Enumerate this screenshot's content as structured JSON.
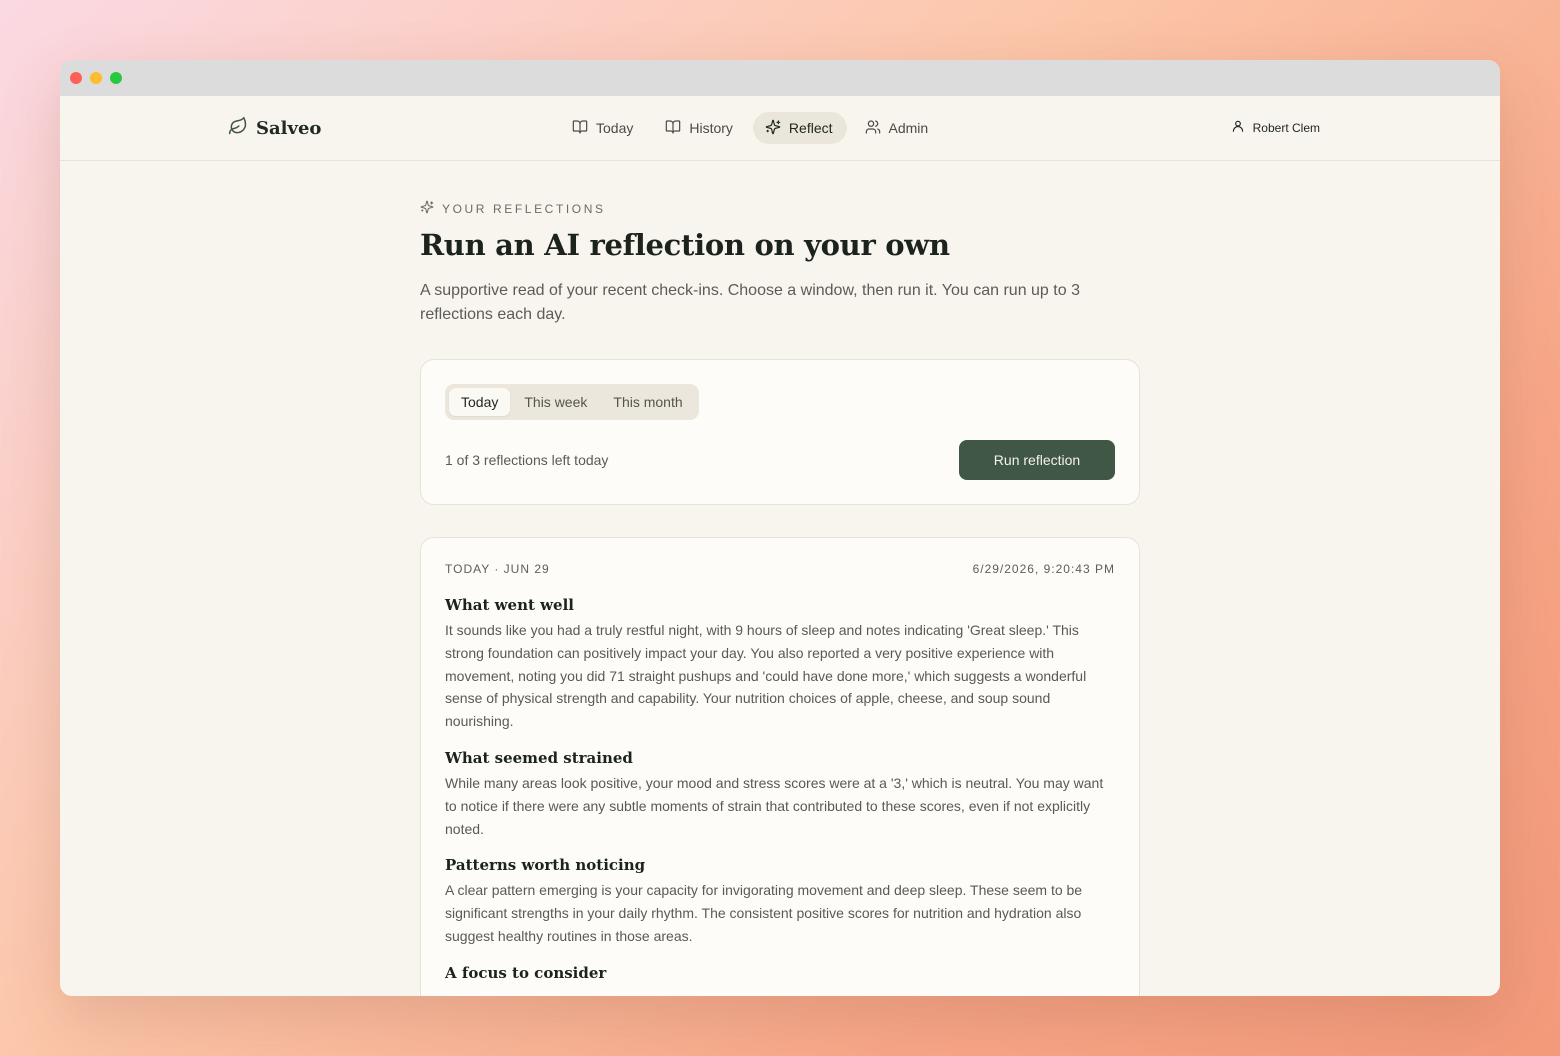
{
  "app": {
    "name": "Salveo"
  },
  "nav": [
    {
      "label": "Today",
      "icon": "book-icon"
    },
    {
      "label": "History",
      "icon": "book-icon"
    },
    {
      "label": "Reflect",
      "icon": "sparkles-icon",
      "active": true
    },
    {
      "label": "Admin",
      "icon": "users-icon"
    }
  ],
  "user": {
    "name": "Robert Clem"
  },
  "page": {
    "eyebrow": "YOUR REFLECTIONS",
    "title": "Run an AI reflection on your own",
    "description": "A supportive read of your recent check-ins. Choose a window, then run it. You can run up to 3 reflections each day."
  },
  "run_card": {
    "windows": [
      "Today",
      "This week",
      "This month"
    ],
    "selected_window": "Today",
    "quota_text": "1 of 3 reflections left today",
    "run_button": "Run reflection"
  },
  "reflection": {
    "label": "TODAY · JUN 29",
    "timestamp": "6/29/2026, 9:20:43 PM",
    "sections": [
      {
        "title": "What went well",
        "body": "It sounds like you had a truly restful night, with 9 hours of sleep and notes indicating 'Great sleep.' This strong foundation can positively impact your day. You also reported a very positive experience with movement, noting you did 71 straight pushups and 'could have done more,' which suggests a wonderful sense of physical strength and capability. Your nutrition choices of apple, cheese, and soup sound nourishing."
      },
      {
        "title": "What seemed strained",
        "body": "While many areas look positive, your mood and stress scores were at a '3,' which is neutral. You may want to notice if there were any subtle moments of strain that contributed to these scores, even if not explicitly noted."
      },
      {
        "title": "Patterns worth noticing",
        "body": "A clear pattern emerging is your capacity for invigorating movement and deep sleep. These seem to be significant strengths in your daily rhythm. The consistent positive scores for nutrition and hydration also suggest healthy routines in those areas."
      },
      {
        "title": "A focus to consider",
        "body": ""
      }
    ]
  },
  "colors": {
    "accent": "#3f5744",
    "background": "#f8f5ef",
    "card": "#fdfcf8"
  }
}
